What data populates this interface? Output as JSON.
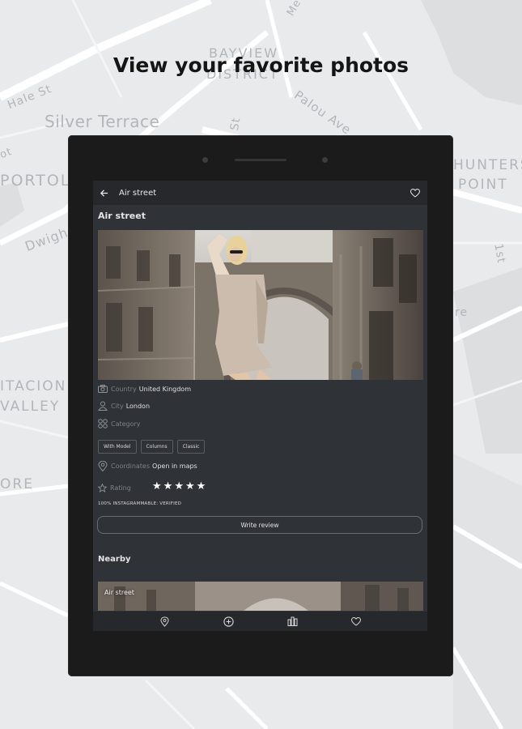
{
  "map": {
    "labels": [
      "Hale St",
      "Silver Terrace",
      "PORTOL",
      "Dwigh",
      "BAYVIEW",
      "DISTRICT",
      "Palou Ave",
      "St",
      "HUNTERS",
      "POINT",
      "1st",
      "ITACION",
      "VALLEY",
      "ORE",
      "ot",
      "Me",
      "re"
    ]
  },
  "headline": "View your favorite photos",
  "app": {
    "toolbar_title": "Air street",
    "place_title": "Air street",
    "country_label": "Country",
    "country_value": "United Kingdom",
    "city_label": "City",
    "city_value": "London",
    "category_label": "Category",
    "categories": [
      "With Model",
      "Columns",
      "Classic"
    ],
    "coordinates_label": "Coordinates",
    "coordinates_value": "Open in maps",
    "rating_label": "Rating",
    "rating_stars": 5,
    "votes_text": "100% INSTAGRAMMABLE: VERIFIED",
    "write_review": "Write review",
    "nearby_title": "Nearby",
    "nearby_card_label": "Air street"
  },
  "icons": {
    "back": "arrow-left-icon",
    "favorite": "heart-icon",
    "country": "camera-icon",
    "city": "person-icon",
    "category": "grid-icon",
    "coordinates": "pin-icon",
    "rating": "star-outline-icon",
    "nav": [
      "map-pin-icon",
      "add-circle-icon",
      "ranking-icon",
      "heart-icon"
    ]
  },
  "colors": {
    "screen_bg": "#2f3237",
    "bar_bg": "#26282c",
    "device": "#1b1b1c",
    "map_bg": "#e9eaeb",
    "headline": "#151515"
  }
}
